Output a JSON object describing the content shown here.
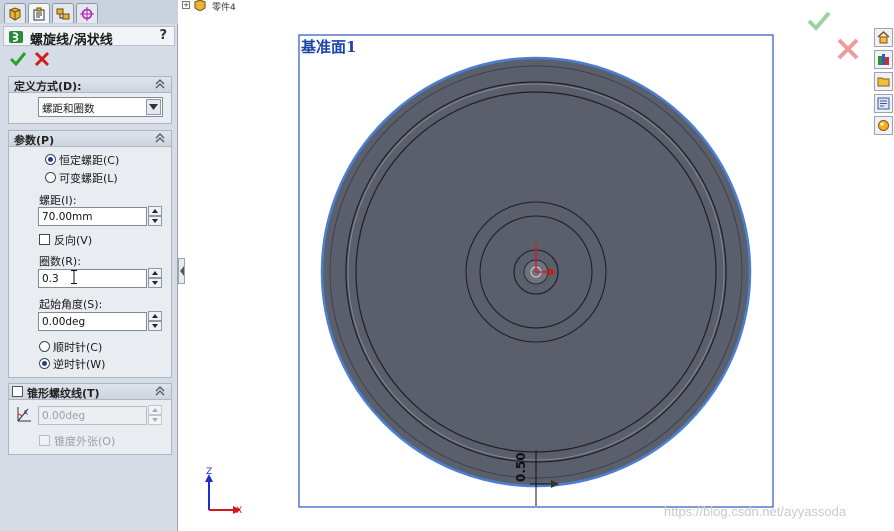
{
  "window": {
    "part_name": "零件4"
  },
  "property_manager": {
    "title": "螺旋线/涡状线",
    "help": "?",
    "definition_group": {
      "header": "定义方式(D):",
      "selected": "螺距和圈数"
    },
    "params_group": {
      "header": "参数(P)",
      "constant_pitch": "恒定螺距(C)",
      "variable_pitch": "可变螺距(L)",
      "pitch_label": "螺距(I):",
      "pitch_value": "70.00mm",
      "reverse_label": "反向(V)",
      "revolutions_label": "圈数(R):",
      "revolutions_value": "0.3",
      "start_angle_label": "起始角度(S):",
      "start_angle_value": "0.00deg",
      "clockwise": "顺时针(C)",
      "counterclockwise": "逆时针(W)"
    },
    "taper_group": {
      "header": "锥形螺纹线(T)",
      "angle_value": "0.00deg",
      "taper_outward": "锥度外张(O)"
    }
  },
  "viewport": {
    "plane_label": "基准面1",
    "dimension_text": "0.50",
    "axis_x": "X",
    "axis_z": "Z"
  },
  "watermark": "https://blog.csdn.net/ayyassoda",
  "colors": {
    "disc_fill": "#5b5f6b",
    "disc_edge": "#4a7fd4",
    "plane_border": "#2d55b8",
    "accept_green": "#2e9d2e",
    "cancel_red": "#d01c1c"
  }
}
